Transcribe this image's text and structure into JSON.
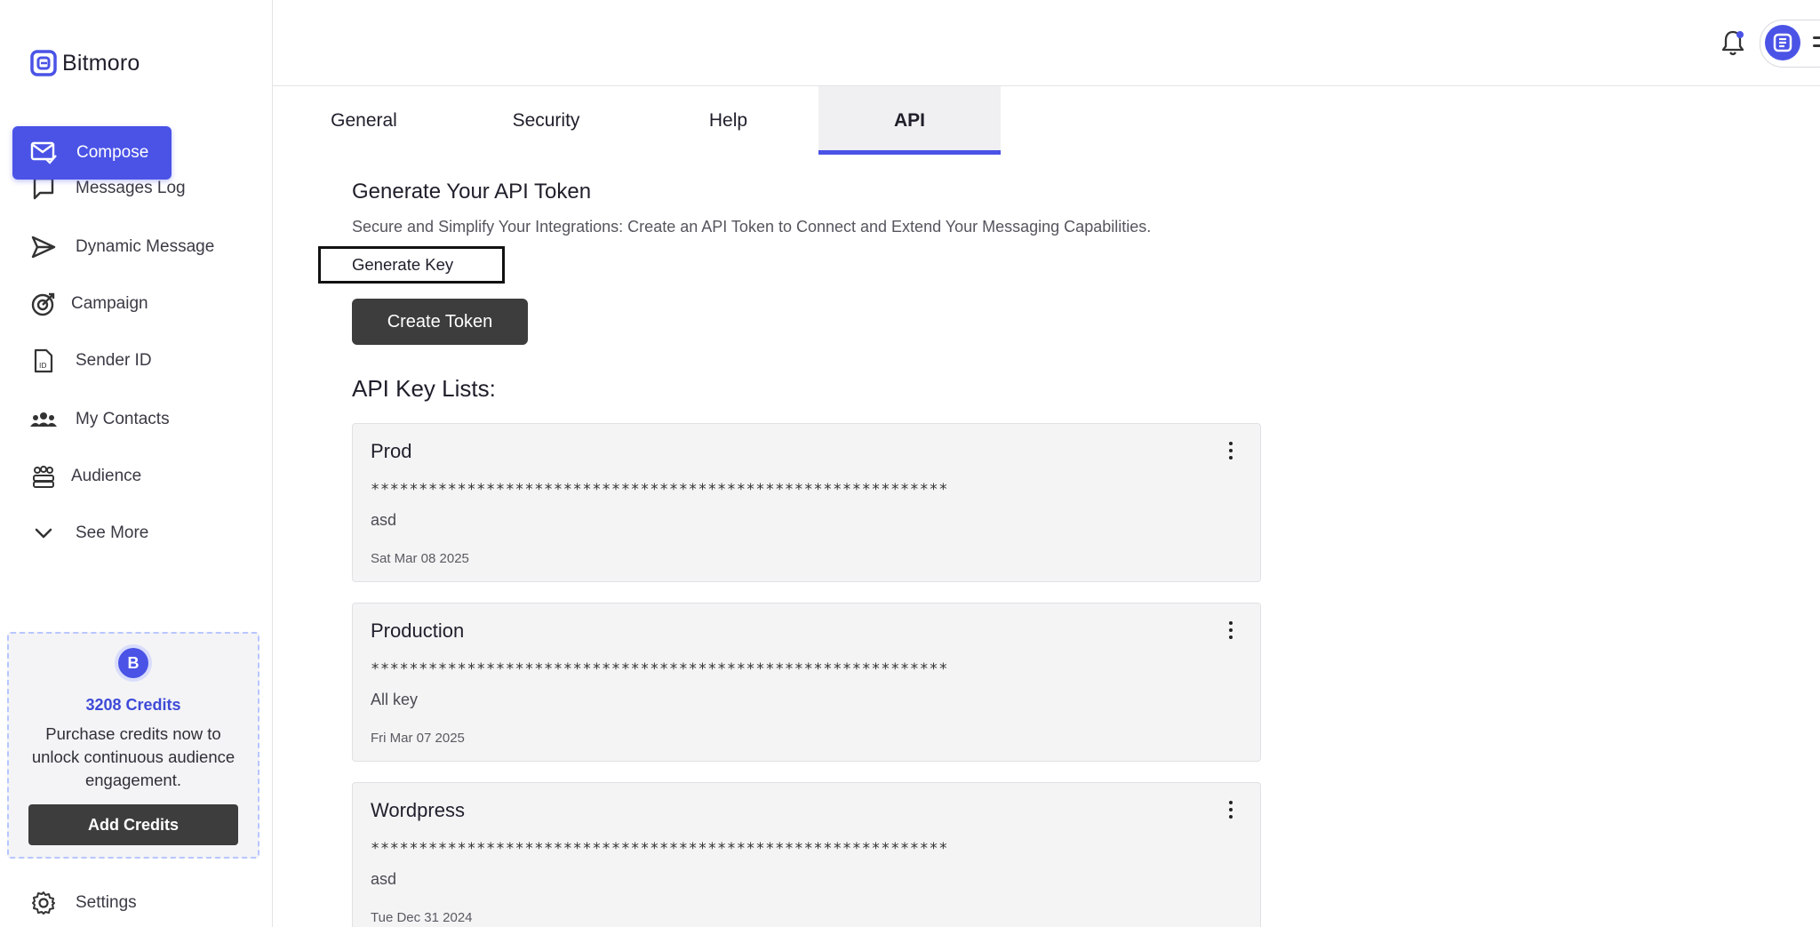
{
  "brand": {
    "name": "Bitmoro"
  },
  "sidebar": {
    "compose": "Compose",
    "items": [
      {
        "label": "Messages Log",
        "icon": "message-square-icon"
      },
      {
        "label": "Dynamic Message",
        "icon": "send-icon"
      },
      {
        "label": "Campaign",
        "icon": "target-icon"
      },
      {
        "label": "Sender ID",
        "icon": "id-file-icon"
      },
      {
        "label": "My Contacts",
        "icon": "users-icon"
      },
      {
        "label": "Audience",
        "icon": "group-icon"
      },
      {
        "label": "See More",
        "icon": "chevron-down-icon"
      }
    ],
    "settings": "Settings"
  },
  "credits": {
    "badge": "B",
    "amount": "3208 Credits",
    "description": "Purchase credits now to unlock continuous audience engagement.",
    "button": "Add Credits"
  },
  "tabs": [
    {
      "label": "General",
      "active": false
    },
    {
      "label": "Security",
      "active": false
    },
    {
      "label": "Help",
      "active": false
    },
    {
      "label": "API",
      "active": true
    }
  ],
  "api": {
    "title": "Generate Your API Token",
    "description": "Secure and Simplify Your Integrations: Create an API Token to Connect and Extend Your Messaging Capabilities.",
    "generate_key": "Generate Key",
    "create_token": "Create Token",
    "list_title": "API Key Lists:",
    "keys": [
      {
        "name": "Prod",
        "masked": "************************************************************",
        "description": "asd",
        "date": "Sat Mar 08 2025"
      },
      {
        "name": "Production",
        "masked": "************************************************************",
        "description": "All key",
        "date": "Fri Mar 07 2025"
      },
      {
        "name": "Wordpress",
        "masked": "************************************************************",
        "description": "asd",
        "date": "Tue Dec 31 2024"
      }
    ]
  },
  "colors": {
    "accent": "#4a53e6",
    "dark_button": "#3d3d3d",
    "card_bg": "#f4f4f5"
  }
}
